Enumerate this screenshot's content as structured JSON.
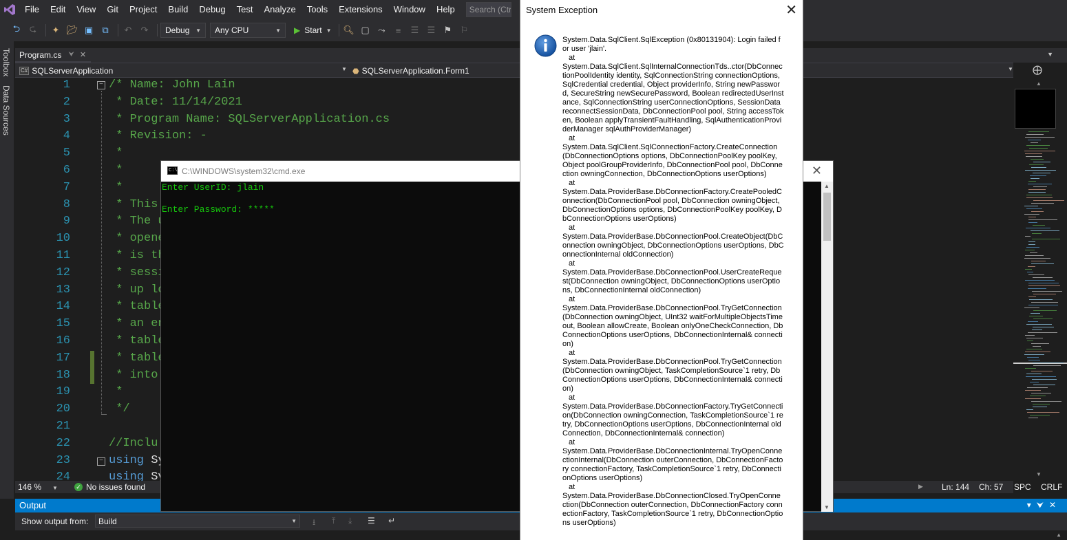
{
  "menubar": {
    "items": [
      "File",
      "Edit",
      "View",
      "Git",
      "Project",
      "Build",
      "Debug",
      "Test",
      "Analyze",
      "Tools",
      "Extensions",
      "Window",
      "Help"
    ],
    "search_placeholder": "Search (Ctrl+Q)"
  },
  "toolbar": {
    "configuration": "Debug",
    "platform": "Any CPU",
    "start_label": "Start"
  },
  "side_tabs": {
    "toolbox": "Toolbox",
    "data_sources": "Data Sources"
  },
  "document_tab": {
    "filename": "Program.cs"
  },
  "navbar": {
    "project": "SQLServerApplication",
    "class": "SQLServerApplication.Form1"
  },
  "editor": {
    "lines": [
      {
        "n": "1",
        "text": "/* Name: John Lain",
        "kind": "comment"
      },
      {
        "n": "2",
        "text": " * Date: 11/14/2021",
        "kind": "comment"
      },
      {
        "n": "3",
        "text": " * Program Name: SQLServerApplication.cs",
        "kind": "comment"
      },
      {
        "n": "4",
        "text": " * Revision: -",
        "kind": "comment"
      },
      {
        "n": "5",
        "text": " *",
        "kind": "comment"
      },
      {
        "n": "6",
        "text": " *",
        "kind": "comment"
      },
      {
        "n": "7",
        "text": " *",
        "kind": "comment"
      },
      {
        "n": "8",
        "text": " * This",
        "kind": "comment"
      },
      {
        "n": "9",
        "text": " * The u",
        "kind": "comment"
      },
      {
        "n": "10",
        "text": " * opene",
        "kind": "comment"
      },
      {
        "n": "11",
        "text": " * is th",
        "kind": "comment"
      },
      {
        "n": "12",
        "text": " * sessi",
        "kind": "comment"
      },
      {
        "n": "13",
        "text": " * up lo",
        "kind": "comment"
      },
      {
        "n": "14",
        "text": " * table",
        "kind": "comment"
      },
      {
        "n": "15",
        "text": " * an en",
        "kind": "comment"
      },
      {
        "n": "16",
        "text": " * table",
        "kind": "comment"
      },
      {
        "n": "17",
        "text": " * table",
        "kind": "comment"
      },
      {
        "n": "18",
        "text": " * into",
        "kind": "comment"
      },
      {
        "n": "19",
        "text": " *",
        "kind": "comment"
      },
      {
        "n": "20",
        "text": " */",
        "kind": "comment"
      },
      {
        "n": "21",
        "text": "",
        "kind": "plain"
      },
      {
        "n": "22",
        "text": "//Inclu",
        "kind": "comment"
      },
      {
        "n": "23",
        "text": "using Sy",
        "kind": "using"
      },
      {
        "n": "24",
        "text": "using Sy",
        "kind": "using"
      }
    ]
  },
  "editor_status": {
    "zoom": "146 %",
    "issues": "No issues found",
    "line": "Ln: 144",
    "char": "Ch: 57",
    "whitespace": "SPC",
    "line_ending": "CRLF"
  },
  "output_panel": {
    "title": "Output",
    "show_output_label": "Show output from:",
    "source": "Build"
  },
  "console": {
    "title": "C:\\WINDOWS\\system32\\cmd.exe",
    "lines": [
      "Enter UserID: jlain",
      "Enter Password: *****"
    ]
  },
  "exception_dialog": {
    "title": "System Exception",
    "paragraphs": [
      "System.Data.SqlClient.SqlException (0x80131904): Login failed for user 'jlain'.",
      "at System.Data.SqlClient.SqlInternalConnectionTds..ctor(DbConnectionPoolIdentity identity, SqlConnectionString connectionOptions, SqlCredential credential, Object providerInfo, String newPassword, SecureString newSecurePassword, Boolean redirectedUserInstance, SqlConnectionString userConnectionOptions, SessionData reconnectSessionData, DbConnectionPool pool, String accessToken, Boolean applyTransientFaultHandling, SqlAuthenticationProviderManager sqlAuthProviderManager)",
      "at System.Data.SqlClient.SqlConnectionFactory.CreateConnection(DbConnectionOptions options, DbConnectionPoolKey poolKey, Object poolGroupProviderInfo, DbConnectionPool pool, DbConnection owningConnection, DbConnectionOptions userOptions)",
      "at System.Data.ProviderBase.DbConnectionFactory.CreatePooledConnection(DbConnectionPool pool, DbConnection owningObject, DbConnectionOptions options, DbConnectionPoolKey poolKey, DbConnectionOptions userOptions)",
      "at System.Data.ProviderBase.DbConnectionPool.CreateObject(DbConnection owningObject, DbConnectionOptions userOptions, DbConnectionInternal oldConnection)",
      "at System.Data.ProviderBase.DbConnectionPool.UserCreateRequest(DbConnection owningObject, DbConnectionOptions userOptions, DbConnectionInternal oldConnection)",
      "at System.Data.ProviderBase.DbConnectionPool.TryGetConnection(DbConnection owningObject, UInt32 waitForMultipleObjectsTimeout, Boolean allowCreate, Boolean onlyOneCheckConnection, DbConnectionOptions userOptions, DbConnectionInternal& connection)",
      "at System.Data.ProviderBase.DbConnectionPool.TryGetConnection(DbConnection owningObject, TaskCompletionSource`1 retry, DbConnectionOptions userOptions, DbConnectionInternal& connection)",
      "at System.Data.ProviderBase.DbConnectionFactory.TryGetConnection(DbConnection owningConnection, TaskCompletionSource`1 retry, DbConnectionOptions userOptions, DbConnectionInternal oldConnection, DbConnectionInternal& connection)",
      "at System.Data.ProviderBase.DbConnectionInternal.TryOpenConnectionInternal(DbConnection outerConnection, DbConnectionFactory connectionFactory, TaskCompletionSource`1 retry, DbConnectionOptions userOptions)",
      "at System.Data.ProviderBase.DbConnectionClosed.TryOpenConnection(DbConnection outerConnection, DbConnectionFactory connectionFactory, TaskCompletionSource`1 retry, DbConnectionOptions userOptions)"
    ]
  },
  "colors": {
    "accent": "#007acc",
    "comment": "#57a64a",
    "keyword": "#569cd6",
    "line_number": "#2b91af",
    "console_text": "#16c60c"
  },
  "icons": [
    "visual-studio-logo",
    "back-icon",
    "forward-icon",
    "new-project-icon",
    "open-folder-icon",
    "save-icon",
    "save-all-icon",
    "undo-icon",
    "redo-icon",
    "play-icon",
    "info-icon",
    "close-icon"
  ]
}
